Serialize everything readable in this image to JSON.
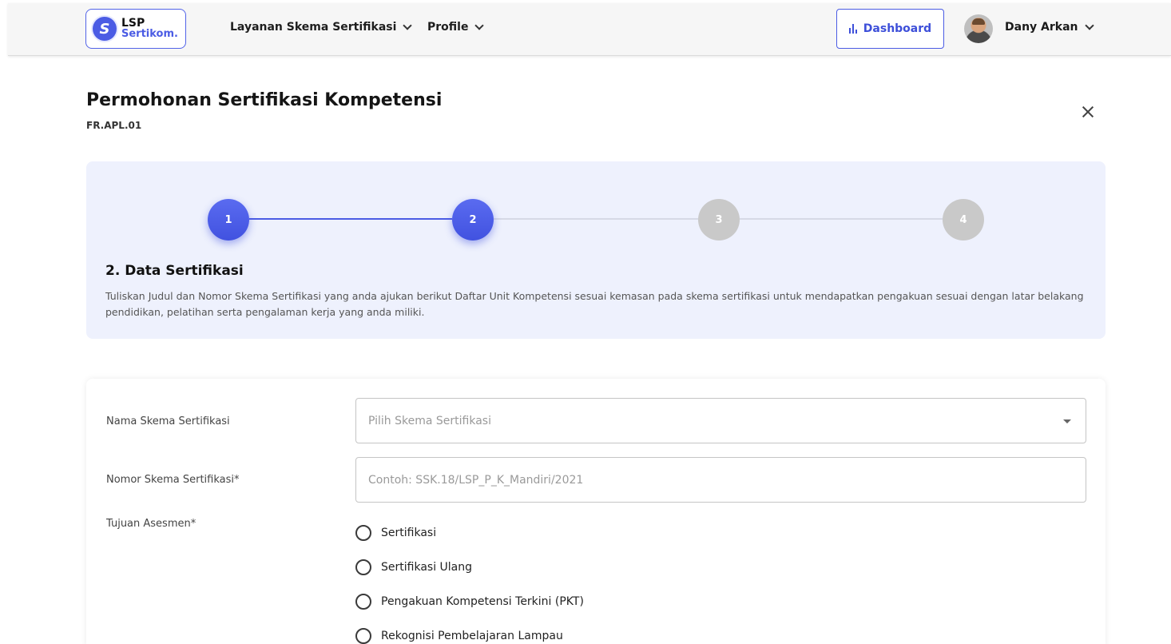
{
  "navbar": {
    "logo_line1": "LSP",
    "logo_line2": "Sertikom.",
    "logo_glyph": "S",
    "menu": [
      {
        "label": "Layanan Skema Sertifikasi"
      },
      {
        "label": "Profile"
      }
    ],
    "dashboard_label": "Dashboard",
    "user_name": "Dany Arkan"
  },
  "page": {
    "title": "Permohonan Sertifikasi Kompetensi",
    "subtitle": "FR.APL.01"
  },
  "stepper": {
    "steps": [
      "1",
      "2",
      "3",
      "4"
    ],
    "current": 2,
    "heading": "2. Data Sertifikasi",
    "description": "Tuliskan Judul dan Nomor Skema Sertifikasi yang anda ajukan berikut Daftar Unit Kompetensi sesuai kemasan pada skema sertifikasi untuk mendapatkan pengakuan sesuai dengan latar belakang pendidikan, pelatihan serta pengalaman kerja yang anda miliki."
  },
  "form": {
    "skema_label": "Nama Skema Sertifikasi",
    "skema_placeholder": "Pilih Skema Sertifikasi",
    "nomor_label": "Nomor Skema Sertifikasi*",
    "nomor_placeholder": "Contoh: SSK.18/LSP_P_K_Mandiri/2021",
    "tujuan_label": "Tujuan Asesmen*",
    "tujuan_options": [
      "Sertifikasi",
      "Sertifikasi Ulang",
      "Pengakuan Kompetensi Terkini (PKT)",
      "Rekognisi Pembelajaran Lampau"
    ]
  },
  "colors": {
    "accent": "#4b5ce4",
    "step_inactive": "#c9c9c9",
    "stepper_bg": "#eef1fd"
  }
}
